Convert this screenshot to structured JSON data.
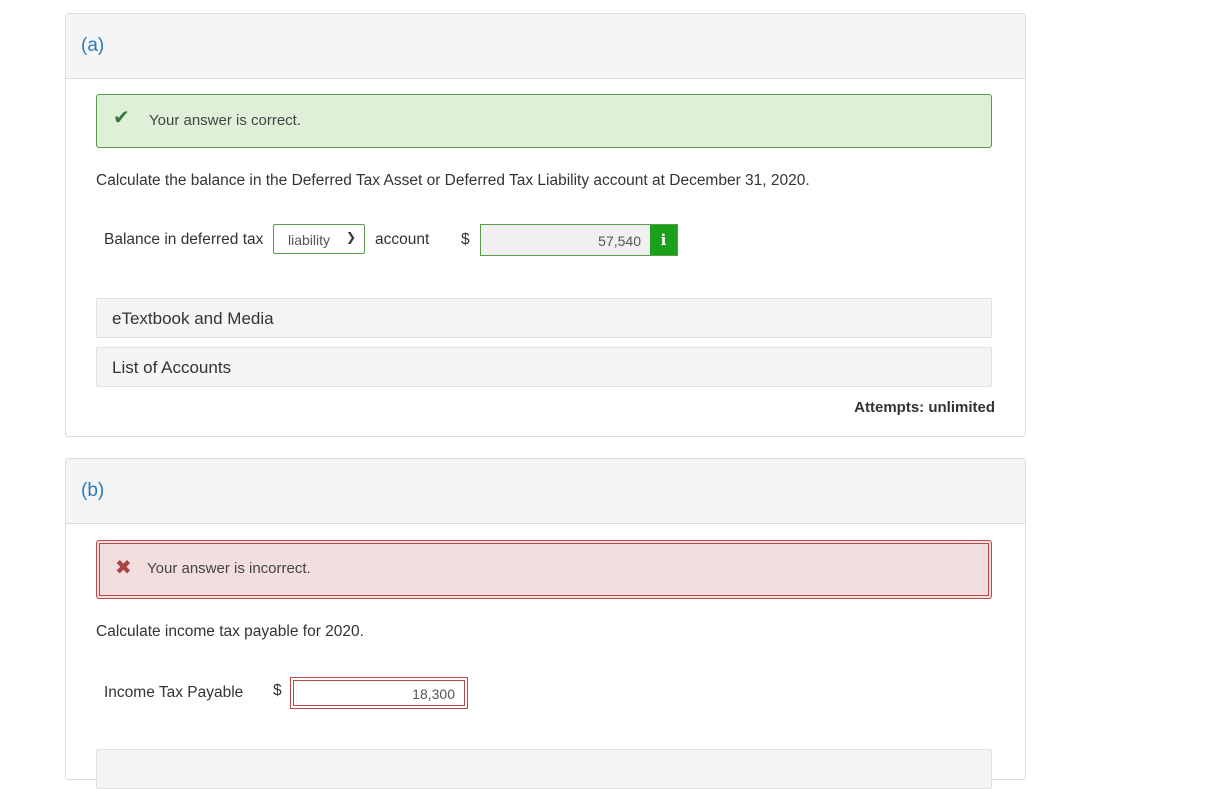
{
  "part_a": {
    "letter": "(a)",
    "alert": {
      "icon": "check-icon",
      "message": "Your answer is correct."
    },
    "question": "Calculate the balance in the Deferred Tax Asset or Deferred Tax Liability account at December 31, 2020.",
    "row": {
      "label_before": "Balance in deferred tax",
      "select_value": "liability",
      "label_after": "account",
      "currency": "$",
      "value": "57,540",
      "info_icon": "i"
    },
    "resources": [
      "eTextbook and Media",
      "List of Accounts"
    ],
    "attempts": "Attempts: unlimited"
  },
  "part_b": {
    "letter": "(b)",
    "alert": {
      "icon": "x-icon",
      "message": "Your answer is incorrect."
    },
    "question": "Calculate income tax payable for 2020.",
    "row": {
      "label": "Income Tax Payable",
      "currency": "$",
      "value": "18,300"
    }
  },
  "colors": {
    "correct_bg": "#dff0d8",
    "correct_border": "#5a9a4f",
    "incorrect_bg": "#f2dede",
    "incorrect_border": "#b94a48",
    "info_button": "#1aa01a",
    "part_letter": "#2a7ab8"
  }
}
